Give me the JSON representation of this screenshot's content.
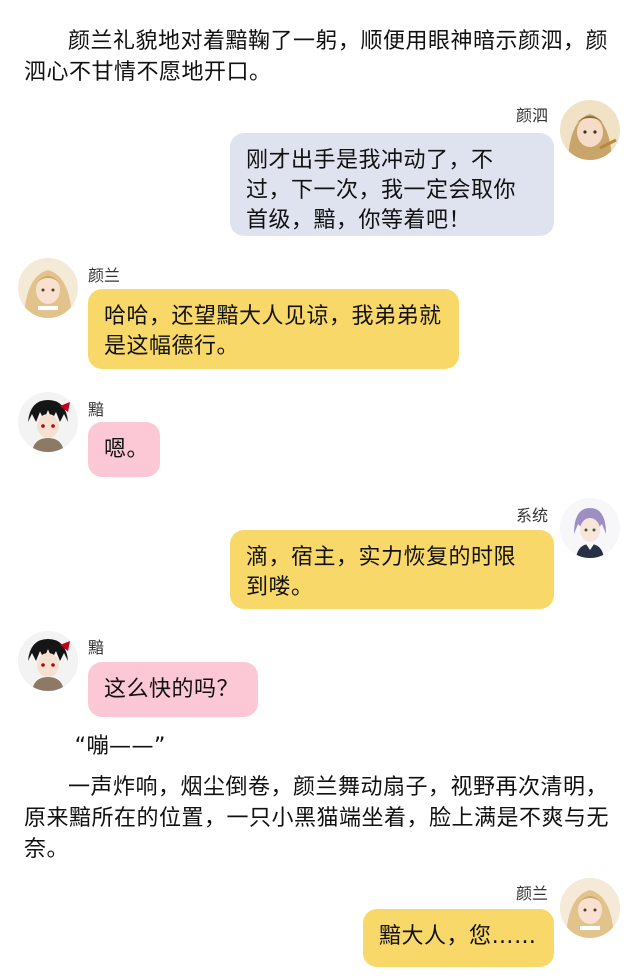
{
  "narration": {
    "p1": "颜兰礼貌地对着黯鞠了一躬，顺便用眼神暗示颜泗，颜泗心不甘情不愿地开口。",
    "p2": "“嘣——”",
    "p3": "一声炸响，烟尘倒卷，颜兰舞动扇子，视野再次清明，原来黯所在的位置，一只小黑猫端坐着，脸上满是不爽与无奈。"
  },
  "messages": [
    {
      "speaker": "颜泗",
      "text": "刚才出手是我冲动了，不过，下一次，我一定会取你首级，黯，你等着吧！",
      "avatar": "yansi-avatar"
    },
    {
      "speaker": "颜兰",
      "text": "哈哈，还望黯大人见谅，我弟弟就是这幅德行。",
      "avatar": "yanlan-avatar"
    },
    {
      "speaker": "黯",
      "text": "嗯。",
      "avatar": "an-avatar"
    },
    {
      "speaker": "系统",
      "text": "滴，宿主，实力恢复的时限到喽。",
      "avatar": "system-avatar"
    },
    {
      "speaker": "黯",
      "text": "这么快的吗？",
      "avatar": "an-avatar"
    },
    {
      "speaker": "颜兰",
      "text": "黯大人，您……",
      "avatar": "yanlan-avatar"
    }
  ],
  "colors": {
    "grey_bubble": "#dfe3ef",
    "yellow_bubble": "#f9d86a",
    "pink_bubble": "#fdc8d5"
  }
}
